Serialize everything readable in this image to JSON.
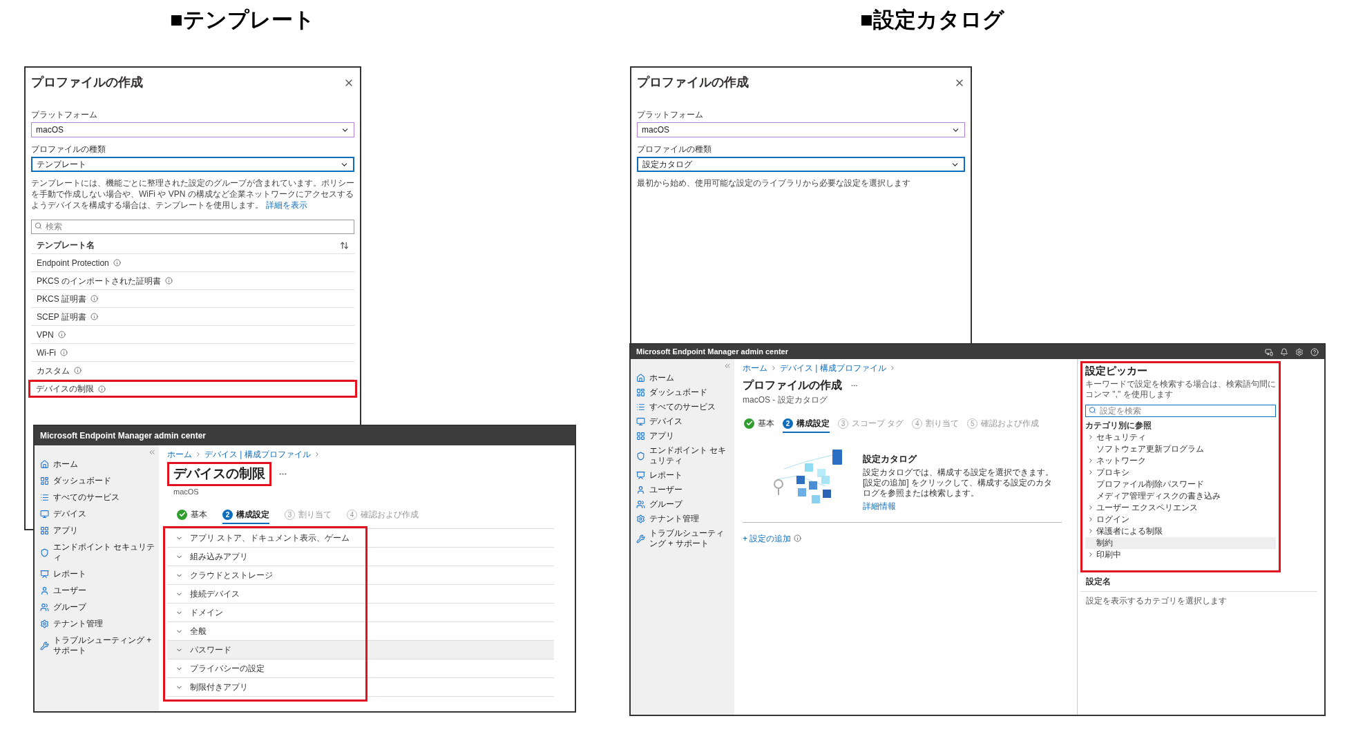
{
  "template_section": {
    "heading": "■テンプレート",
    "dialog": {
      "title": "プロファイルの作成",
      "platform": {
        "label": "プラットフォーム",
        "value": "macOS"
      },
      "profile_type": {
        "label": "プロファイルの種類",
        "value": "テンプレート"
      },
      "description": "テンプレートには、機能ごとに整理された設定のグループが含まれています。ポリシーを手動で作成しない場合や、WiFi や VPN の構成など企業ネットワークにアクセスするようデバイスを構成する場合は、テンプレートを使用します。",
      "link": "詳細を表示",
      "search_placeholder": "検索",
      "column": "テンプレート名",
      "rows": [
        {
          "name": "Endpoint Protection",
          "highlighted": false
        },
        {
          "name": "PKCS のインポートされた証明書",
          "highlighted": false
        },
        {
          "name": "PKCS 証明書",
          "highlighted": false
        },
        {
          "name": "SCEP 証明書",
          "highlighted": false
        },
        {
          "name": "VPN",
          "highlighted": false
        },
        {
          "name": "Wi-Fi",
          "highlighted": false
        },
        {
          "name": "カスタム",
          "highlighted": false
        },
        {
          "name": "デバイスの制限",
          "highlighted": true
        }
      ]
    },
    "portal": {
      "app_title": "Microsoft Endpoint Manager admin center",
      "nav": [
        "ホーム",
        "ダッシュボード",
        "すべてのサービス",
        "デバイス",
        "アプリ",
        "エンドポイント セキュリティ",
        "レポート",
        "ユーザー",
        "グループ",
        "テナント管理",
        "トラブルシューティング + サポート"
      ],
      "breadcrumb": [
        "ホーム",
        "デバイス | 構成プロファイル"
      ],
      "title": "デバイスの制限",
      "title_highlighted": true,
      "subtitle": "macOS",
      "steps": [
        {
          "label": "基本",
          "completed": true,
          "selected": false
        },
        {
          "number": "2",
          "label": "構成設定",
          "completed": false,
          "selected": true
        },
        {
          "number": "3",
          "label": "割り当て",
          "completed": false,
          "selected": false
        },
        {
          "number": "4",
          "label": "確認および作成",
          "completed": false,
          "selected": false
        }
      ],
      "sections_highlighted": true,
      "sections": [
        {
          "label": "アプリ ストア、ドキュメント表示、ゲーム",
          "hovered": false
        },
        {
          "label": "組み込みアプリ",
          "hovered": false
        },
        {
          "label": "クラウドとストレージ",
          "hovered": false
        },
        {
          "label": "接続デバイス",
          "hovered": false
        },
        {
          "label": "ドメイン",
          "hovered": false
        },
        {
          "label": "全般",
          "hovered": false
        },
        {
          "label": "パスワード",
          "hovered": true
        },
        {
          "label": "プライバシーの設定",
          "hovered": false
        },
        {
          "label": "制限付きアプリ",
          "hovered": false
        }
      ]
    }
  },
  "catalog_section": {
    "heading": "■設定カタログ",
    "dialog": {
      "title": "プロファイルの作成",
      "platform": {
        "label": "プラットフォーム",
        "value": "macOS"
      },
      "profile_type": {
        "label": "プロファイルの種類",
        "value": "設定カタログ"
      },
      "description": "最初から始め、使用可能な設定のライブラリから必要な設定を選択します"
    },
    "portal": {
      "app_title": "Microsoft Endpoint Manager admin center",
      "nav": [
        "ホーム",
        "ダッシュボード",
        "すべてのサービス",
        "デバイス",
        "アプリ",
        "エンドポイント セキュリティ",
        "レポート",
        "ユーザー",
        "グループ",
        "テナント管理",
        "トラブルシューティング + サポート"
      ],
      "breadcrumb": [
        "ホーム",
        "デバイス | 構成プロファイル"
      ],
      "title": "プロファイルの作成",
      "subtitle": "macOS - 設定カタログ",
      "steps": [
        {
          "label": "基本",
          "completed": true,
          "selected": false
        },
        {
          "number": "2",
          "label": "構成設定",
          "completed": false,
          "selected": true
        },
        {
          "number": "3",
          "label": "スコープ タグ",
          "completed": false,
          "selected": false
        },
        {
          "number": "4",
          "label": "割り当て",
          "completed": false,
          "selected": false
        },
        {
          "number": "5",
          "label": "確認および作成",
          "completed": false,
          "selected": false
        }
      ],
      "catalog": {
        "title": "設定カタログ",
        "description": "設定カタログでは、構成する設定を選択できます。[設定の追加] をクリックして、構成する設定のカタログを参照または検索します。",
        "link": "詳細情報",
        "add_button": "+ 設定の追加"
      },
      "picker": {
        "title": "設定ピッカー",
        "highlighted": true,
        "hint": "キーワードで設定を検索する場合は、検索語句間にコンマ \",\" を使用します",
        "search_placeholder": "設定を検索",
        "category_heading": "カテゴリ別に参照",
        "categories": [
          {
            "label": "セキュリティ",
            "expandable": true,
            "selected": false
          },
          {
            "label": "ソフトウェア更新プログラム",
            "expandable": false,
            "selected": false
          },
          {
            "label": "ネットワーク",
            "expandable": true,
            "selected": false
          },
          {
            "label": "プロキシ",
            "expandable": true,
            "selected": false
          },
          {
            "label": "プロファイル削除パスワード",
            "expandable": false,
            "selected": false
          },
          {
            "label": "メディア管理ディスクの書き込み",
            "expandable": false,
            "selected": false
          },
          {
            "label": "ユーザー エクスペリエンス",
            "expandable": true,
            "selected": false
          },
          {
            "label": "ログイン",
            "expandable": true,
            "selected": false
          },
          {
            "label": "保護者による制限",
            "expandable": true,
            "selected": false
          },
          {
            "label": "制約",
            "expandable": false,
            "selected": true
          },
          {
            "label": "印刷中",
            "expandable": true,
            "selected": false
          }
        ],
        "column": "設定名",
        "empty_message": "設定を表示するカテゴリを選択します"
      }
    }
  }
}
